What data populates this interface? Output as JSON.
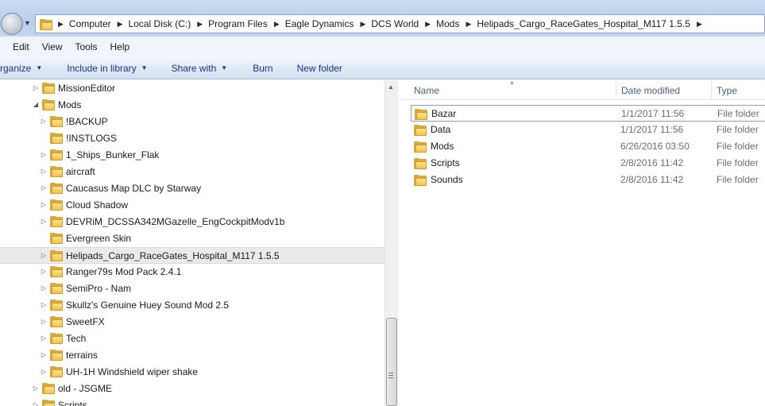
{
  "address_bar": {
    "crumbs": [
      "Computer",
      "Local Disk (C:)",
      "Program Files",
      "Eagle Dynamics",
      "DCS World",
      "Mods",
      "Helipads_Cargo_RaceGates_Hospital_M117 1.5.5"
    ]
  },
  "menu": {
    "items": [
      "Edit",
      "View",
      "Tools",
      "Help"
    ]
  },
  "toolbar": {
    "organize": "rganize",
    "include_in_library": "Include in library",
    "share_with": "Share with",
    "burn": "Burn",
    "new_folder": "New folder"
  },
  "nav_tree": {
    "items": [
      {
        "label": "MissionEditor",
        "expander": "collapsed",
        "level": 1
      },
      {
        "label": "Mods",
        "expander": "expanded",
        "level": 1
      },
      {
        "label": "!BACKUP",
        "expander": "collapsed",
        "level": 2
      },
      {
        "label": "!INSTLOGS",
        "expander": "none",
        "level": 2
      },
      {
        "label": "1_Ships_Bunker_Flak",
        "expander": "collapsed",
        "level": 2
      },
      {
        "label": "aircraft",
        "expander": "collapsed",
        "level": 2
      },
      {
        "label": "Caucasus Map DLC by Starway",
        "expander": "collapsed",
        "level": 2
      },
      {
        "label": "Cloud Shadow",
        "expander": "collapsed",
        "level": 2
      },
      {
        "label": "DEVRiM_DCSSA342MGazelle_EngCockpitModv1b",
        "expander": "collapsed",
        "level": 2
      },
      {
        "label": "Evergreen Skin",
        "expander": "none",
        "level": 2
      },
      {
        "label": "Helipads_Cargo_RaceGates_Hospital_M117 1.5.5",
        "expander": "collapsed",
        "level": 2,
        "selected": true
      },
      {
        "label": "Ranger79s Mod Pack 2.4.1",
        "expander": "collapsed",
        "level": 2
      },
      {
        "label": "SemiPro - Nam",
        "expander": "collapsed",
        "level": 2
      },
      {
        "label": "Skullz's Genuine Huey Sound Mod 2.5",
        "expander": "collapsed",
        "level": 2
      },
      {
        "label": "SweetFX",
        "expander": "collapsed",
        "level": 2
      },
      {
        "label": "Tech",
        "expander": "collapsed",
        "level": 2
      },
      {
        "label": "terrains",
        "expander": "collapsed",
        "level": 2
      },
      {
        "label": "UH-1H Windshield wiper shake",
        "expander": "collapsed",
        "level": 2
      },
      {
        "label": "old - JSGME",
        "expander": "collapsed",
        "level": 1
      },
      {
        "label": "Scripts",
        "expander": "collapsed",
        "level": 1
      }
    ]
  },
  "file_list": {
    "columns": {
      "name": "Name",
      "date_modified": "Date modified",
      "type": "Type"
    },
    "rows": [
      {
        "name": "Bazar",
        "date": "1/1/2017 11:56",
        "type": "File folder",
        "focused": true
      },
      {
        "name": "Data",
        "date": "1/1/2017 11:56",
        "type": "File folder"
      },
      {
        "name": "Mods",
        "date": "6/26/2016 03:50",
        "type": "File folder"
      },
      {
        "name": "Scripts",
        "date": "2/8/2016 11:42",
        "type": "File folder"
      },
      {
        "name": "Sounds",
        "date": "2/8/2016 11:42",
        "type": "File folder"
      }
    ]
  },
  "colors": {
    "folder": "#f3c250",
    "command_text": "#1e3287",
    "header_text": "#4c607a",
    "selection": "#eaeaea"
  }
}
